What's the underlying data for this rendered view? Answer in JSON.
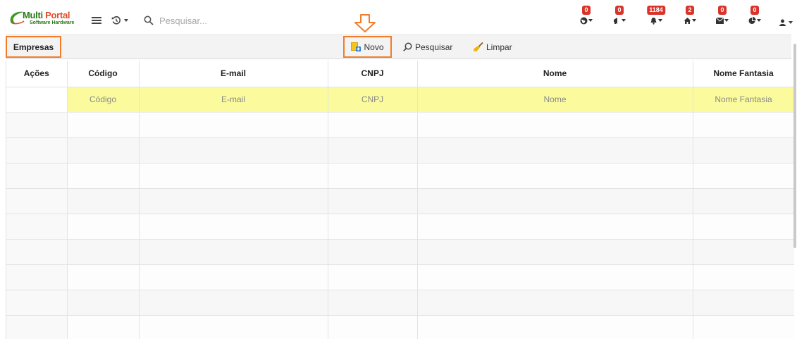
{
  "app": {
    "logo_title_1": "Multi",
    "logo_title_2": "Portal",
    "logo_subtitle": "Software Hardware"
  },
  "header": {
    "search_placeholder": "Pesquisar...",
    "notifications": [
      {
        "icon": "globe-icon",
        "count": "0"
      },
      {
        "icon": "megaphone-icon",
        "count": "0"
      },
      {
        "icon": "bell-icon",
        "count": "1184"
      },
      {
        "icon": "home-icon",
        "count": "2"
      },
      {
        "icon": "envelope-icon",
        "count": "0"
      },
      {
        "icon": "chart-pie-icon",
        "count": "0"
      }
    ]
  },
  "toolbar": {
    "breadcrumb": "Empresas",
    "new_label": "Novo",
    "search_label": "Pesquisar",
    "clear_label": "Limpar"
  },
  "table": {
    "columns": [
      "Ações",
      "Código",
      "E-mail",
      "CNPJ",
      "Nome",
      "Nome Fantasia"
    ],
    "filters": [
      "",
      "Código",
      "E-mail",
      "CNPJ",
      "Nome",
      "Nome Fantasia"
    ]
  },
  "colors": {
    "highlight": "#f27c2a",
    "filter_row": "#fbfb9e",
    "badge": "#d9342b",
    "logo_green": "#2a7a18",
    "logo_red": "#e04b2a"
  }
}
